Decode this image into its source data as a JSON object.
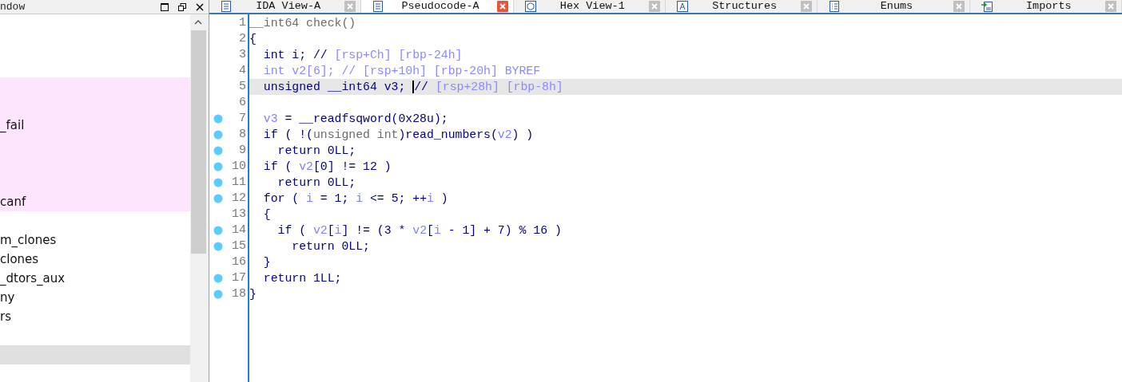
{
  "left_pane": {
    "title": "ndow",
    "rows": [
      {
        "kind": "blank"
      },
      {
        "kind": "blank"
      },
      {
        "kind": "blank"
      },
      {
        "text": "",
        "highlighted": true,
        "selected": false
      },
      {
        "text": "",
        "highlighted": true,
        "selected": false
      },
      {
        "text": "_fail",
        "highlighted": true,
        "selected": false
      },
      {
        "text": "",
        "highlighted": true,
        "selected": false
      },
      {
        "text": "",
        "highlighted": true,
        "selected": false
      },
      {
        "text": "",
        "highlighted": true,
        "selected": false
      },
      {
        "text": "canf",
        "highlighted": true,
        "selected": false
      },
      {
        "kind": "blank"
      },
      {
        "text": "m_clones",
        "highlighted": false,
        "selected": false
      },
      {
        "text": "clones",
        "highlighted": false,
        "selected": false
      },
      {
        "text": "_dtors_aux",
        "highlighted": false,
        "selected": false
      },
      {
        "text": "ny",
        "highlighted": false,
        "selected": false
      },
      {
        "text": "rs",
        "highlighted": false,
        "selected": false
      },
      {
        "kind": "blank"
      },
      {
        "text": "",
        "highlighted": false,
        "selected": true
      }
    ]
  },
  "tabs": [
    {
      "label": "IDA View-A",
      "selected": false
    },
    {
      "label": "Pseudocode-A",
      "selected": true
    },
    {
      "label": "Hex View-1",
      "selected": false
    },
    {
      "label": "Structures",
      "selected": false
    },
    {
      "label": "Enums",
      "selected": false
    },
    {
      "label": "Imports",
      "selected": false
    }
  ],
  "code_lines": [
    {
      "number": "1",
      "dot": false,
      "current": false,
      "segments": [
        {
          "text": "__int64 check()",
          "kind": "plain"
        }
      ]
    },
    {
      "number": "2",
      "dot": false,
      "current": false,
      "segments": [
        {
          "text": "{",
          "kind": "code"
        }
      ]
    },
    {
      "number": "3",
      "dot": false,
      "current": false,
      "segments": [
        {
          "text": "  int i; // ",
          "kind": "code"
        },
        {
          "text": "[rsp+Ch] [rbp-24h]",
          "kind": "comment"
        }
      ]
    },
    {
      "number": "4",
      "dot": false,
      "current": false,
      "segments": [
        {
          "text": "  int v2[6]; // [rsp+10h] [rbp-20h] BYREF",
          "kind": "comment"
        }
      ]
    },
    {
      "number": "5",
      "dot": false,
      "current": true,
      "segments": [
        {
          "text": "  unsigned __int64 v3; ",
          "kind": "code"
        },
        {
          "text": "// ",
          "kind": "code",
          "caret": true
        },
        {
          "text": "[rsp+28h] [rbp-8h]",
          "kind": "comment"
        }
      ]
    },
    {
      "number": "6",
      "dot": false,
      "current": false
    },
    {
      "number": "7",
      "dot": true,
      "current": false,
      "segments": [
        {
          "text": "  v3",
          "kind": "var"
        },
        {
          "text": " = __readfsqword(0x28u);",
          "kind": "code"
        }
      ]
    },
    {
      "number": "8",
      "dot": true,
      "current": false,
      "segments": [
        {
          "text": "  if ( !(",
          "kind": "code"
        },
        {
          "text": "unsigned int",
          "kind": "plain"
        },
        {
          "text": ")read_numbers(",
          "kind": "code"
        },
        {
          "text": "v2",
          "kind": "var"
        },
        {
          "text": ") )",
          "kind": "code"
        }
      ]
    },
    {
      "number": "9",
      "dot": true,
      "current": false,
      "segments": [
        {
          "text": "    return 0LL;",
          "kind": "code"
        }
      ]
    },
    {
      "number": "10",
      "dot": true,
      "current": false,
      "segments": [
        {
          "text": "  if ( ",
          "kind": "code"
        },
        {
          "text": "v2",
          "kind": "var"
        },
        {
          "text": "[0] != 12 )",
          "kind": "code"
        }
      ]
    },
    {
      "number": "11",
      "dot": true,
      "current": false,
      "segments": [
        {
          "text": "    return 0LL;",
          "kind": "code"
        }
      ]
    },
    {
      "number": "12",
      "dot": true,
      "current": false,
      "segments": [
        {
          "text": "  for ( ",
          "kind": "code"
        },
        {
          "text": "i",
          "kind": "var"
        },
        {
          "text": " = 1; ",
          "kind": "code"
        },
        {
          "text": "i",
          "kind": "var"
        },
        {
          "text": " <= 5; ++",
          "kind": "code"
        },
        {
          "text": "i",
          "kind": "var"
        },
        {
          "text": " )",
          "kind": "code"
        }
      ]
    },
    {
      "number": "13",
      "dot": false,
      "current": false,
      "segments": [
        {
          "text": "  {",
          "kind": "code"
        }
      ]
    },
    {
      "number": "14",
      "dot": true,
      "current": false,
      "segments": [
        {
          "text": "    if ( ",
          "kind": "code"
        },
        {
          "text": "v2",
          "kind": "var"
        },
        {
          "text": "[",
          "kind": "code"
        },
        {
          "text": "i",
          "kind": "var"
        },
        {
          "text": "] != (3 * ",
          "kind": "code"
        },
        {
          "text": "v2",
          "kind": "var"
        },
        {
          "text": "[",
          "kind": "code"
        },
        {
          "text": "i",
          "kind": "var"
        },
        {
          "text": " - 1] + 7) % 16 )",
          "kind": "code"
        }
      ]
    },
    {
      "number": "15",
      "dot": true,
      "current": false,
      "segments": [
        {
          "text": "      return 0LL;",
          "kind": "code"
        }
      ]
    },
    {
      "number": "16",
      "dot": false,
      "current": false,
      "segments": [
        {
          "text": "  }",
          "kind": "code"
        }
      ]
    },
    {
      "number": "17",
      "dot": true,
      "current": false,
      "segments": [
        {
          "text": "  return 1LL;",
          "kind": "code"
        }
      ]
    },
    {
      "number": "18",
      "dot": true,
      "current": false,
      "segments": [
        {
          "text": "}",
          "kind": "code"
        }
      ]
    }
  ]
}
